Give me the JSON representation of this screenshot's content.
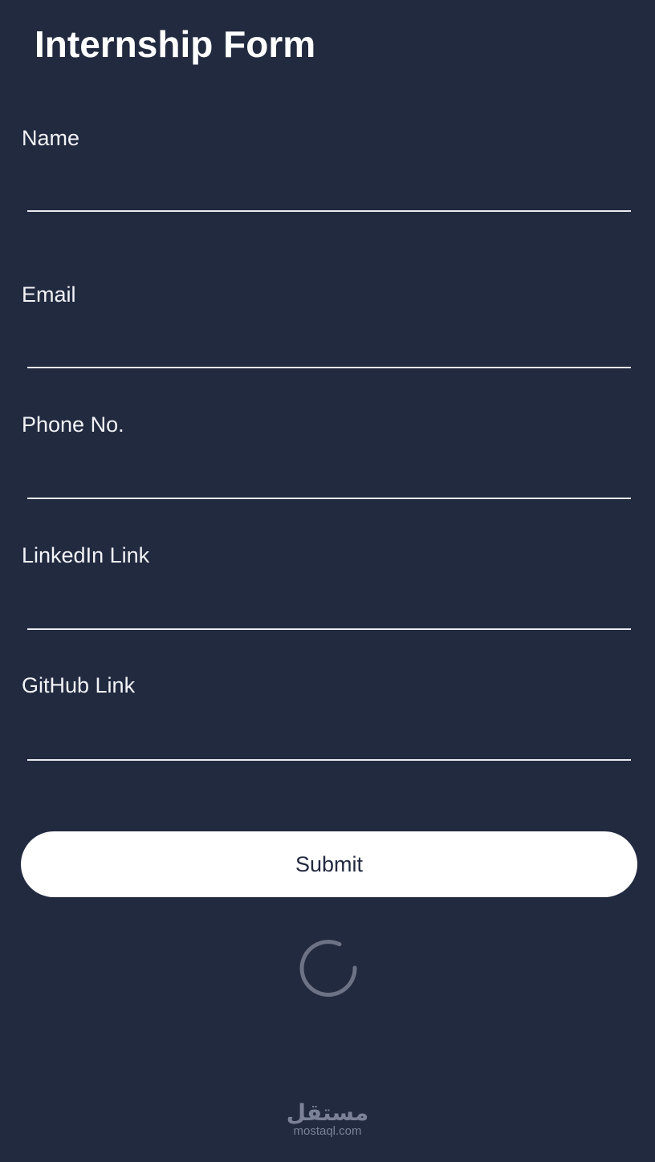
{
  "app": {
    "title": "Internship Form"
  },
  "form": {
    "fields": [
      {
        "label": "Name",
        "value": "",
        "placeholder": ""
      },
      {
        "label": "Email",
        "value": "",
        "placeholder": ""
      },
      {
        "label": "Phone No.",
        "value": "",
        "placeholder": ""
      },
      {
        "label": "LinkedIn Link",
        "value": "",
        "placeholder": ""
      },
      {
        "label": "GitHub Link",
        "value": "",
        "placeholder": ""
      }
    ],
    "submit_label": "Submit"
  },
  "status": {
    "loading_icon": "spinner-icon"
  },
  "watermark": {
    "logo_text": "مستقل",
    "domain": "mostaql.com"
  },
  "colors": {
    "background": "#222a40",
    "text": "#ffffff",
    "button_bg": "#ffffff",
    "button_text": "#222a40",
    "spinner": "#6d7285",
    "watermark": "#7b8196"
  }
}
